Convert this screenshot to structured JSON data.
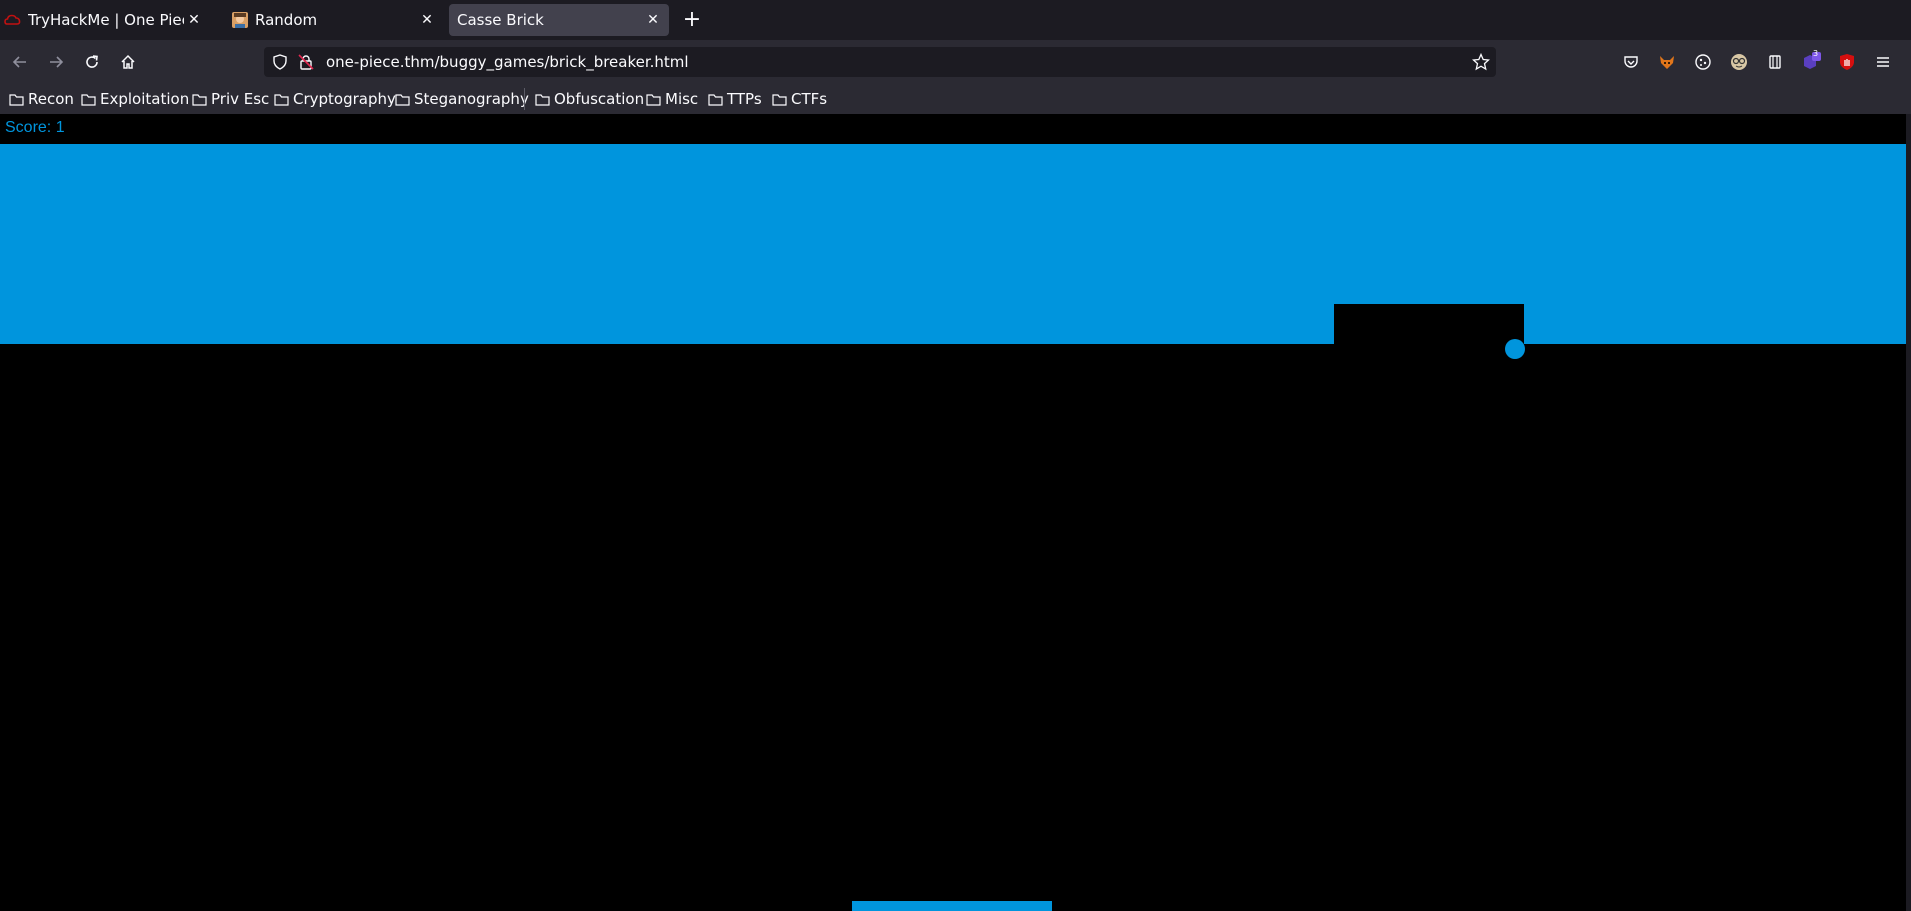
{
  "browser": {
    "tabs": [
      {
        "label": "TryHackMe | One Piece",
        "icon": "tryhackme-icon",
        "active": false
      },
      {
        "label": "Random",
        "icon": "avatar-icon",
        "active": false
      },
      {
        "label": "Casse Brick",
        "icon": "",
        "active": true
      }
    ],
    "url": "one-piece.thm/buggy_games/brick_breaker.html",
    "bookmarks": [
      {
        "label": "Recon"
      },
      {
        "label": "Exploitation"
      },
      {
        "label": "Priv Esc"
      },
      {
        "label": "Cryptography"
      },
      {
        "label": "Steganography"
      },
      {
        "label": "Obfuscation"
      },
      {
        "label": "Misc"
      },
      {
        "label": "TTPs"
      },
      {
        "label": "CTFs"
      }
    ],
    "toolbar_icons": [
      "pocket-icon",
      "fox-extension-icon",
      "cookie-icon",
      "glasses-extension-icon",
      "sidebar-icon",
      "extension-badge-icon",
      "ublock-icon",
      "menu-icon"
    ],
    "extension_badge_count": "3"
  },
  "game": {
    "score_label": "Score: ",
    "score_value": "1",
    "colors": {
      "brick": "#0095dd",
      "ball": "#0095dd",
      "paddle": "#0095dd",
      "background": "#000000"
    }
  }
}
